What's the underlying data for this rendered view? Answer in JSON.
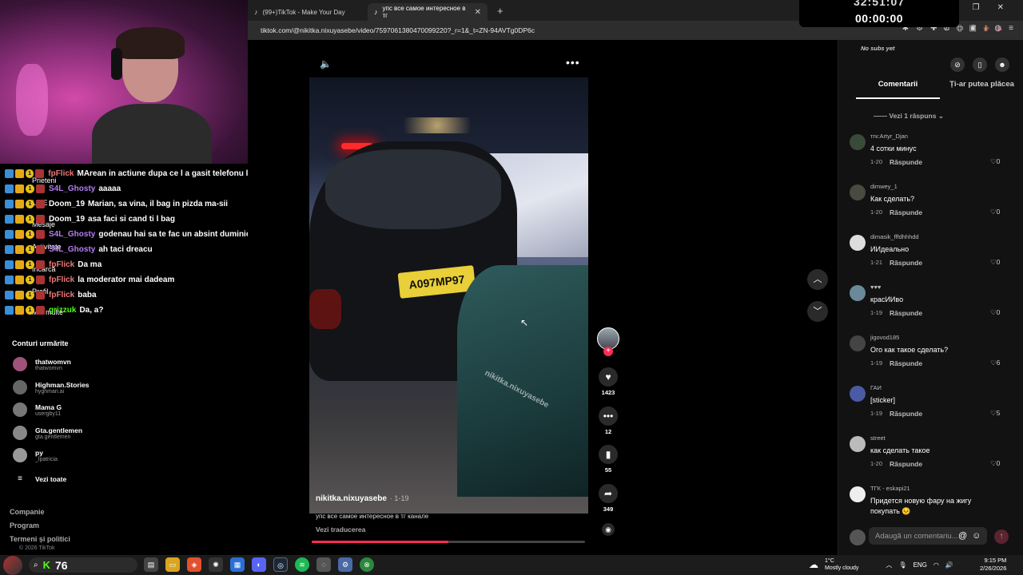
{
  "browser": {
    "tabs": [
      {
        "label": "(99+)TikTok - Make Your Day",
        "active": false
      },
      {
        "label": "упс все самое интересное в тг",
        "active": true
      }
    ],
    "url": "tiktok.com/@nikitka.nixuyasebe/video/7597061380470099220?_r=1&_t=ZN-94AVTg0DP6c"
  },
  "overlay": {
    "timer_top": "32:51:07",
    "timer": "00:00:00"
  },
  "chat": [
    {
      "user": "fpFlick",
      "msg": "MArean in actiune dupa ce l a gasit telefonu lui vadim",
      "color": "#e77"
    },
    {
      "user": "S4L_Ghosty",
      "msg": "aaaaa",
      "color": "#b57cf5"
    },
    {
      "user": "Doom_19",
      "msg": "Marian, sa vina, il bag in pizda ma-sii",
      "color": "#fff"
    },
    {
      "user": "Doom_19",
      "msg": "asa faci si cand ti l bag",
      "color": "#fff"
    },
    {
      "user": "S4L_Ghosty",
      "msg": "godenau hai sa te fac un absint duminica bine",
      "color": "#b57cf5"
    },
    {
      "user": "S4L_Ghosty",
      "msg": "ah taci dreacu",
      "color": "#b57cf5"
    },
    {
      "user": "fpFlick",
      "msg": "Da ma",
      "color": "#e77"
    },
    {
      "user": "fpFlick",
      "msg": "la moderator mai dadeam",
      "color": "#e77"
    },
    {
      "user": "fpFlick",
      "msg": "baba",
      "color": "#e77"
    },
    {
      "user": "grizzuk",
      "msg": "Da, a?",
      "color": "#53fc18"
    }
  ],
  "sidebar": {
    "menu": [
      "Prieteni",
      "LIVE",
      "Mesaje",
      "Activitate",
      "Încarcă",
      "Profil",
      "Mai multe"
    ],
    "following_title": "Conturi urmărite",
    "following": [
      {
        "name": "thatwomvn",
        "handle": "thatwomvn"
      },
      {
        "name": "Highman.Stories",
        "handle": "hyghman.ai"
      },
      {
        "name": "Mama G",
        "handle": "usergby11"
      },
      {
        "name": "Gta.gentlemen",
        "handle": "gta.gentlemen"
      },
      {
        "name": "py",
        "handle": "_lpatricia"
      }
    ],
    "see_all": "Vezi toate",
    "footer": [
      "Companie",
      "Program",
      "Termeni și politici"
    ],
    "copyright": "© 2026 TikTok"
  },
  "video": {
    "author": "nikitka.nixuyasebe",
    "date": "· 1-19",
    "caption": "упс все самое интересное в тг канале",
    "translate": "Vezi traducerea",
    "plate": "A097MP97",
    "watermark": "nikitka.nixuyasebe",
    "progress": 0.5
  },
  "actions": {
    "likes": "1423",
    "comments": "12",
    "saves": "55",
    "shares": "349"
  },
  "comments": {
    "nosubs": "No subs yet",
    "tabs": [
      "Comentarii",
      "Ți-ar putea plăcea"
    ],
    "replies_toggle": "Vezi 1 răspuns",
    "reply_label": "Răspunde",
    "items": [
      {
        "user": "тгк:Artyr_Djan",
        "text": "4 сотки минус",
        "date": "1-20",
        "likes": "0"
      },
      {
        "user": "dimwey_1",
        "text": "Как сделать?",
        "date": "1-20",
        "likes": "0"
      },
      {
        "user": "dimasik_fffdhhhdd",
        "text": "ИИдеально",
        "date": "1-21",
        "likes": "0"
      },
      {
        "user": "♥♥♥",
        "text": "красИИво",
        "date": "1-19",
        "likes": "0"
      },
      {
        "user": "jigovod185",
        "text": "Ого как такое сделать?",
        "date": "1-19",
        "likes": "6"
      },
      {
        "user": "ГАИ",
        "text": "[sticker]",
        "date": "1-19",
        "likes": "5"
      },
      {
        "user": "street",
        "text": "как сделать такое",
        "date": "1-20",
        "likes": "0"
      },
      {
        "user": "ТГК - eskapi21",
        "text": "Придется новую фару на жигу покупать 😣",
        "date": "",
        "likes": ""
      }
    ],
    "add_placeholder": "Adaugă un comentariu..."
  },
  "taskbar": {
    "kick_count": "76",
    "weather_temp": "1°C",
    "weather_desc": "Mostly cloudy",
    "lang": "ENG",
    "time": "9:15 PM",
    "date": "2/26/2026"
  }
}
